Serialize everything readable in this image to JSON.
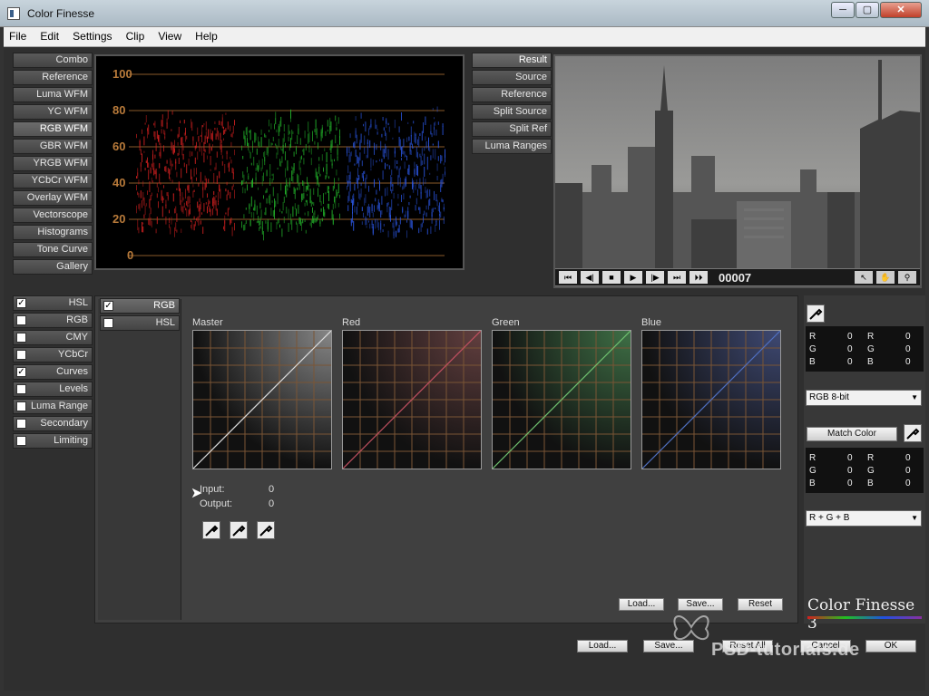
{
  "window": {
    "title": "Color Finesse",
    "min_label": "─",
    "max_label": "▢",
    "close_label": "✕"
  },
  "menu": [
    "File",
    "Edit",
    "Settings",
    "Clip",
    "View",
    "Help"
  ],
  "scope_tabs": [
    "Combo",
    "Reference",
    "Luma WFM",
    "YC WFM",
    "RGB WFM",
    "GBR WFM",
    "YRGB WFM",
    "YCbCr WFM",
    "Overlay WFM",
    "Vectorscope",
    "Histograms",
    "Tone Curve",
    "Gallery"
  ],
  "scope_active": "RGB WFM",
  "waveform": {
    "y_labels": [
      "100",
      "80",
      "60",
      "40",
      "20",
      "0"
    ],
    "channel_colors": [
      "#d22020",
      "#22b22a",
      "#2a55e0"
    ]
  },
  "preview_tabs": [
    "Result",
    "Source",
    "Reference",
    "Split Source",
    "Split Ref",
    "Luma Ranges"
  ],
  "transport": {
    "buttons": [
      "⏮",
      "◀|",
      "■",
      "▶",
      "|▶",
      "⏭",
      "⏵⏵"
    ],
    "timecode": "00007"
  },
  "correction_tabs": [
    {
      "label": "HSL",
      "checked": true
    },
    {
      "label": "RGB",
      "checked": false
    },
    {
      "label": "CMY",
      "checked": false
    },
    {
      "label": "YCbCr",
      "checked": false
    },
    {
      "label": "Curves",
      "checked": true
    },
    {
      "label": "Levels",
      "checked": false
    },
    {
      "label": "Luma Range",
      "checked": false
    },
    {
      "label": "Secondary",
      "checked": false
    },
    {
      "label": "Limiting",
      "checked": false
    }
  ],
  "curves_subtabs": [
    {
      "label": "RGB",
      "checked": true
    },
    {
      "label": "HSL",
      "checked": false
    }
  ],
  "curves": [
    {
      "label": "Master",
      "line_color": "#dddddd",
      "glow": "rgba(220,220,220,0.45)"
    },
    {
      "label": "Red",
      "line_color": "#c05060",
      "glow": "rgba(200,60,60,0.25)"
    },
    {
      "label": "Green",
      "line_color": "#70c070",
      "glow": "rgba(60,200,80,0.35)"
    },
    {
      "label": "Blue",
      "line_color": "#5070c0",
      "glow": "rgba(60,90,210,0.35)"
    }
  ],
  "io": {
    "input_label": "Input:",
    "input_value": "0",
    "output_label": "Output:",
    "output_value": "0"
  },
  "curve_buttons": {
    "load": "Load...",
    "save": "Save...",
    "reset": "Reset"
  },
  "readout_top": [
    [
      "R",
      "0",
      "R",
      "0"
    ],
    [
      "G",
      "0",
      "G",
      "0"
    ],
    [
      "B",
      "0",
      "B",
      "0"
    ]
  ],
  "readout_bottom": [
    [
      "R",
      "0",
      "R",
      "0"
    ],
    [
      "G",
      "0",
      "G",
      "0"
    ],
    [
      "B",
      "0",
      "B",
      "0"
    ]
  ],
  "bitdepth_select": "RGB 8-bit",
  "match_color_label": "Match Color",
  "channel_select": "R + G + B",
  "brand": "Color Finesse 3",
  "footer_buttons": {
    "load": "Load...",
    "save": "Save...",
    "reset_all": "Reset All",
    "cancel": "Cancel",
    "ok": "OK"
  },
  "watermark": "PSD-tutorials.de"
}
